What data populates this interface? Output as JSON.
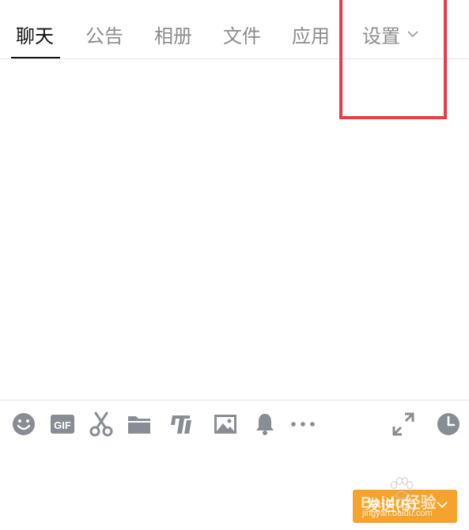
{
  "tabs": [
    {
      "label": "聊天",
      "active": true
    },
    {
      "label": "公告",
      "active": false
    },
    {
      "label": "相册",
      "active": false
    },
    {
      "label": "文件",
      "active": false
    },
    {
      "label": "应用",
      "active": false
    },
    {
      "label": "设置",
      "active": false,
      "has_dropdown": true
    }
  ],
  "highlight": {
    "target": "tab-settings",
    "color": "#ee3a43"
  },
  "toolbar": {
    "icons": [
      "emoji-icon",
      "gif-icon",
      "screenshot-scissors-icon",
      "folder-icon",
      "flash-image-icon",
      "image-icon",
      "bell-icon",
      "more-icon",
      "expand-icon",
      "history-clock-icon"
    ],
    "gif_label": "GIF",
    "icon_color": "#888c94"
  },
  "send_button": {
    "label": "发送(S)",
    "color": "#f5a32c",
    "has_dropdown": true
  },
  "watermark": {
    "brand": "Baidu经验",
    "url": "jingyan.baidu.com"
  }
}
